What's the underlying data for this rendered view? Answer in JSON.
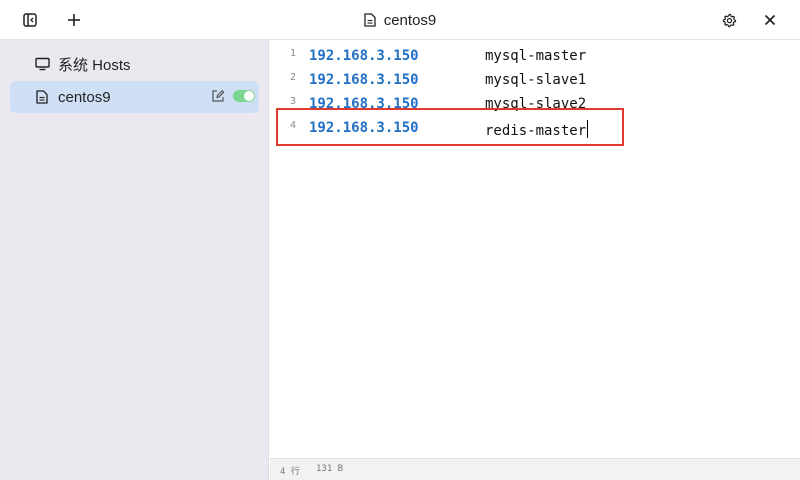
{
  "titlebar": {
    "title": "centos9",
    "toggle_sidebar_icon": "sidebar-toggle-icon",
    "add_icon": "plus-icon",
    "settings_icon": "gear-icon",
    "close_icon": "close-icon"
  },
  "sidebar": {
    "items": [
      {
        "label": "系统 Hosts",
        "icon": "monitor-icon",
        "active": false
      },
      {
        "label": "centos9",
        "icon": "document-icon",
        "active": true,
        "enabled": true
      }
    ]
  },
  "editor": {
    "lines": [
      {
        "number": "1",
        "ip": "192.168.3.150",
        "host": "mysql-master"
      },
      {
        "number": "2",
        "ip": "192.168.3.150",
        "host": "mysql-slave1"
      },
      {
        "number": "3",
        "ip": "192.168.3.150",
        "host": "mysql-slave2"
      },
      {
        "number": "4",
        "ip": "192.168.3.150",
        "host": "redis-master"
      }
    ]
  },
  "statusbar": {
    "lines": "4 行",
    "size": "131 B"
  },
  "colors": {
    "ip": "#1f6fc4",
    "active_item": "#cfdff5",
    "sidebar_bg": "#ebe8f0",
    "toggle_on": "#7ed491",
    "highlight": "#e03a2f"
  }
}
